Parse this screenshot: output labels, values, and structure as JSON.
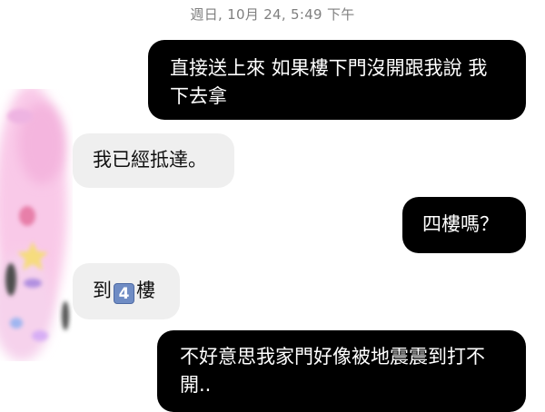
{
  "conversation": {
    "timestamp": "週日, 10月 24, 5:49 下午",
    "messages": [
      {
        "sender": "me",
        "text": "直接送上來 如果樓下門沒開跟我說 我下去拿"
      },
      {
        "sender": "them",
        "text": "我已經抵達。"
      },
      {
        "sender": "me",
        "text": "四樓嗎？"
      },
      {
        "sender": "them",
        "text_before": "到",
        "emoji": "4",
        "text_after": "樓"
      },
      {
        "sender": "me",
        "text": "不好意思我家門好像被地震震到打不開.."
      }
    ]
  },
  "colors": {
    "outgoing_bubble": "#000000",
    "incoming_bubble": "#efefef",
    "timestamp_text": "#7f7f7f",
    "avatar_tint": "#f7c6e6"
  },
  "icons": {
    "avatar": "blurred-sticker-avatar",
    "keycap_emoji": "keycap-digit-four"
  }
}
